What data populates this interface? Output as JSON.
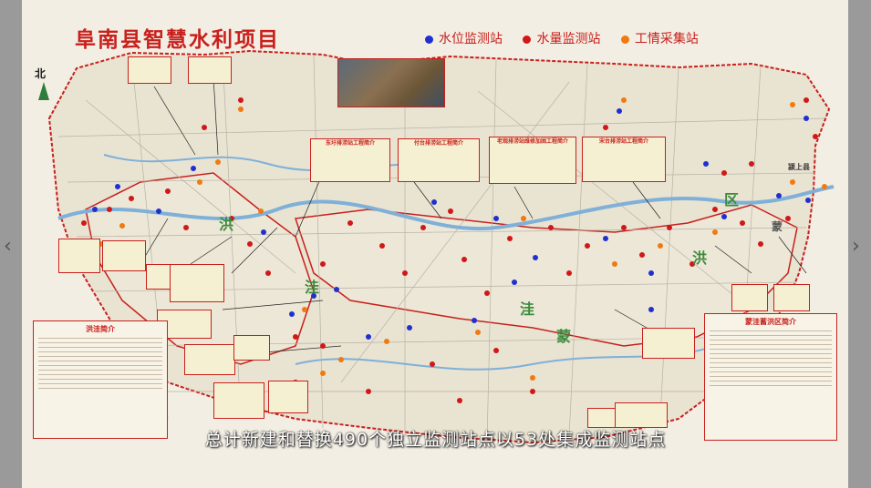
{
  "title": "阜南县智慧水利项目",
  "legend": [
    {
      "label": "水位监测站",
      "color": "#2030d0"
    },
    {
      "label": "水量监测站",
      "color": "#d01818"
    },
    {
      "label": "工情采集站",
      "color": "#f07a10"
    }
  ],
  "compass": "北",
  "project_boxes": [
    {
      "title": "东圩排涝站工程简介"
    },
    {
      "title": "付台排涝站工程简介"
    },
    {
      "title": "老观排涝站维修加固工程简介"
    },
    {
      "title": "宋台排涝站工程简介"
    }
  ],
  "map_labels": {
    "h1": "洪",
    "h2": "洼",
    "h3": "区",
    "m1": "洪",
    "m2": "洼",
    "m3": "蒙",
    "e1": "区",
    "e2": "洪",
    "e3": "蒙",
    "county": "颍上县"
  },
  "info_panels": [
    {
      "title": "洪洼简介"
    },
    {
      "title": "蒙洼蓄洪区简介"
    }
  ],
  "subtitle": "总计新建和替换490个独立监测站点以53处集成监测站点",
  "colors": {
    "accent": "#c8201c",
    "river": "#7fb0d8",
    "region_border": "#c8201c"
  }
}
